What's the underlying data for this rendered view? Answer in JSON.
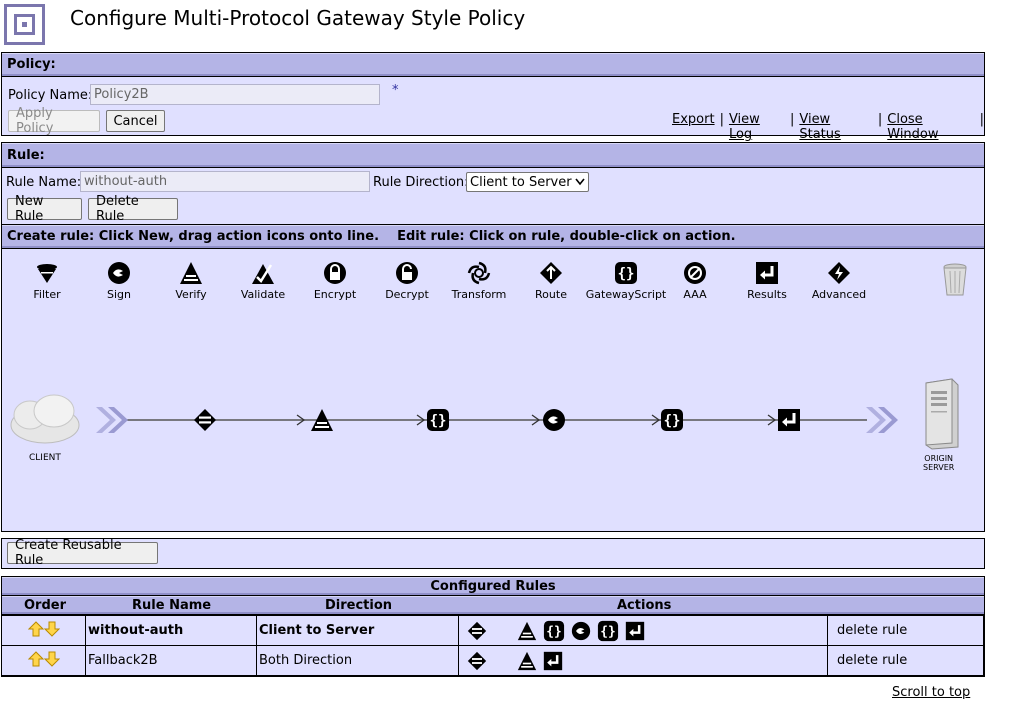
{
  "page": {
    "title": "Configure Multi-Protocol Gateway Style Policy"
  },
  "policy": {
    "header": "Policy:",
    "name_label": "Policy Name:",
    "name_value": "Policy2B",
    "required_mark": "*",
    "apply_label": "Apply Policy",
    "cancel_label": "Cancel",
    "links": {
      "export": "Export",
      "view_log": "View Log",
      "view_status": "View Status",
      "close_window": "Close Window"
    },
    "separator": "|"
  },
  "rule": {
    "header": "Rule:",
    "name_label": "Rule Name:",
    "name_value": "without-auth",
    "direction_label": "Rule Direction:",
    "direction_value": "Client to Server",
    "new_label": "New Rule",
    "delete_label": "Delete Rule"
  },
  "editor": {
    "instructions": "Create rule: Click New, drag action icons onto line.    Edit rule: Click on rule, double-click on action.",
    "tools": [
      {
        "label": "Filter",
        "icon": "filter-icon"
      },
      {
        "label": "Sign",
        "icon": "sign-icon"
      },
      {
        "label": "Verify",
        "icon": "verify-icon"
      },
      {
        "label": "Validate",
        "icon": "validate-icon"
      },
      {
        "label": "Encrypt",
        "icon": "encrypt-icon"
      },
      {
        "label": "Decrypt",
        "icon": "decrypt-icon"
      },
      {
        "label": "Transform",
        "icon": "transform-icon"
      },
      {
        "label": "Route",
        "icon": "route-icon"
      },
      {
        "label": "GatewayScript",
        "icon": "gatewayscript-icon"
      },
      {
        "label": "AAA",
        "icon": "aaa-icon"
      },
      {
        "label": "Results",
        "icon": "results-icon"
      },
      {
        "label": "Advanced",
        "icon": "advanced-icon"
      }
    ],
    "client_label": "CLIENT",
    "server_label_1": "ORIGIN",
    "server_label_2": "SERVER"
  },
  "reusable": {
    "label": "Create Reusable Rule"
  },
  "configured": {
    "title": "Configured Rules",
    "columns": [
      "Order",
      "Rule Name",
      "Direction",
      "Actions"
    ],
    "rows": [
      {
        "name": "without-auth",
        "direction": "Client to Server",
        "delete": "delete rule"
      },
      {
        "name": "Fallback2B",
        "direction": "Both Direction",
        "delete": "delete rule"
      }
    ]
  },
  "footer": {
    "scroll_top": "Scroll to top"
  },
  "colors": {
    "panel": "#e0e0ff",
    "header": "#b4b4e6",
    "accent": "#7b76ad"
  }
}
